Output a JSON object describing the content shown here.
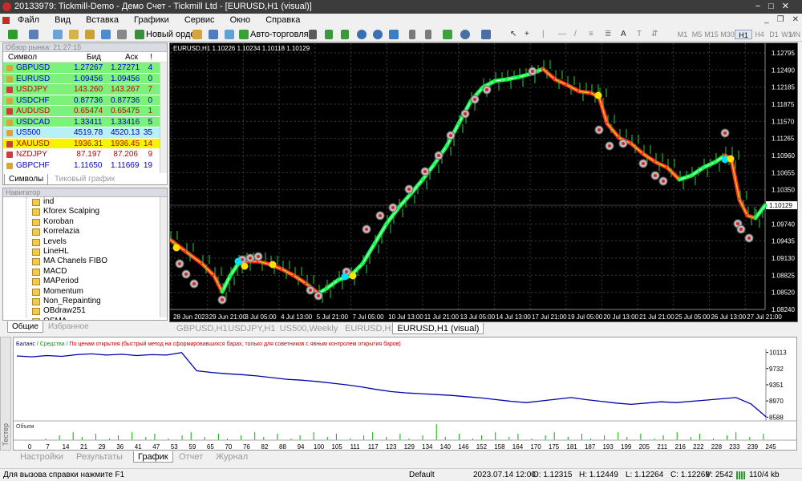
{
  "window": {
    "title": "20133979: Tickmill-Demo - Демо Счет - Tickmill Ltd - [EURUSD,H1 (visual)]"
  },
  "menu": [
    "Файл",
    "Вид",
    "Вставка",
    "Графики",
    "Сервис",
    "Окно",
    "Справка"
  ],
  "toolbar": {
    "new_order": "Новый ордер",
    "autotrading": "Авто-торговля",
    "timeframes": [
      "M1",
      "M5",
      "M15",
      "M30",
      "H1",
      "H4",
      "D1",
      "W1",
      "MN"
    ],
    "active_timeframe": "H1"
  },
  "market_watch": {
    "header": "Обзор рынка: 21:27:15",
    "columns": {
      "symbol": "Символ",
      "bid": "Бид",
      "ask": "Аск",
      "spread": "!"
    },
    "rows": [
      {
        "symbol": "GBPUSD",
        "bid": "1.27267",
        "ask": "1.27271",
        "spread": "4",
        "bg": "#7cf27c",
        "color": "#0000cc"
      },
      {
        "symbol": "EURUSD",
        "bid": "1.09456",
        "ask": "1.09456",
        "spread": "0",
        "bg": "#7cf27c",
        "color": "#0000cc"
      },
      {
        "symbol": "USDJPY",
        "bid": "143.260",
        "ask": "143.267",
        "spread": "7",
        "bg": "#7cf27c",
        "color": "#cc0000"
      },
      {
        "symbol": "USDCHF",
        "bid": "0.87736",
        "ask": "0.87736",
        "spread": "0",
        "bg": "#7cf27c",
        "color": "#0000cc"
      },
      {
        "symbol": "AUDUSD",
        "bid": "0.65474",
        "ask": "0.65475",
        "spread": "1",
        "bg": "#7cf27c",
        "color": "#cc0000"
      },
      {
        "symbol": "USDCAD",
        "bid": "1.33411",
        "ask": "1.33416",
        "spread": "5",
        "bg": "#7cf27c",
        "color": "#0000cc"
      },
      {
        "symbol": "US500",
        "bid": "4519.78",
        "ask": "4520.13",
        "spread": "35",
        "bg": "#b8f0f8",
        "color": "#0000cc"
      },
      {
        "symbol": "XAUUSD",
        "bid": "1936.31",
        "ask": "1936.45",
        "spread": "14",
        "bg": "#f5f500",
        "color": "#cc0000"
      },
      {
        "symbol": "NZDJPY",
        "bid": "87.197",
        "ask": "87.206",
        "spread": "9",
        "bg": "#ffffff",
        "color": "#cc0000"
      },
      {
        "symbol": "GBPCHF",
        "bid": "1.11650",
        "ask": "1.11669",
        "spread": "19",
        "bg": "#ffffff",
        "color": "#0000cc"
      }
    ],
    "tabs": [
      "Символы",
      "Тиковый график"
    ]
  },
  "navigator": {
    "header": "Навигатор",
    "items": [
      "ind",
      "Kforex Scalping",
      "Koroban",
      "Korrelazia",
      "Levels",
      "LineHL",
      "MA Chanels FIBO",
      "MACD",
      "MAPeriod",
      "Momentum",
      "Non_Repainting",
      "OBdraw251",
      "OSMA"
    ],
    "tabs": [
      "Общие",
      "Избранное"
    ]
  },
  "chart": {
    "info": "EURUSD,H1  1.10226 1.10234 1.10118 1.10129",
    "price_labels": [
      "1.12795",
      "1.12490",
      "1.12185",
      "1.11875",
      "1.11570",
      "1.11265",
      "1.10960",
      "1.10655",
      "1.10350",
      "1.10045",
      "1.09740",
      "1.09435",
      "1.09130",
      "1.08825",
      "1.08520",
      "1.08240"
    ],
    "current_price": "1.10129",
    "time_labels": [
      "28 Jun 2023",
      "29 Jun 21:00",
      "3 Jul 05:00",
      "4 Jul 13:00",
      "5 Jul 21:00",
      "7 Jul 05:00",
      "10 Jul 13:00",
      "11 Jul 21:00",
      "13 Jul 05:00",
      "14 Jul 13:00",
      "17 Jul 21:00",
      "19 Jul 05:00",
      "20 Jul 13:00",
      "21 Jul 21:00",
      "25 Jul 05:00",
      "26 Jul 13:00",
      "27 Jul 21:00"
    ],
    "tabs": [
      "GBPUSD,H1",
      "USDJPY,H1",
      "US500,Weekly",
      "EURUSD,H1",
      "EURUSD,H1 (visual)"
    ],
    "active_tab": "EURUSD,H1 (visual)"
  },
  "tester": {
    "legend_balance": "Баланс",
    "legend_equity": "Средства",
    "legend_mode": "По ценам открытия (быстрый метод на сформировавшихся барах, только для советников с явным контролем открытия баров)",
    "volume_label": "Объем",
    "y_labels": [
      "10113",
      "9732",
      "9351",
      "8970",
      "8588"
    ],
    "x_labels": [
      "0",
      "7",
      "14",
      "21",
      "29",
      "36",
      "41",
      "47",
      "53",
      "59",
      "65",
      "70",
      "76",
      "82",
      "88",
      "94",
      "100",
      "105",
      "111",
      "117",
      "123",
      "129",
      "134",
      "140",
      "146",
      "152",
      "158",
      "164",
      "170",
      "175",
      "181",
      "187",
      "193",
      "199",
      "205",
      "211",
      "216",
      "222",
      "228",
      "233",
      "239",
      "245"
    ],
    "tabs": [
      "Настройки",
      "Результаты",
      "График",
      "Отчет",
      "Журнал"
    ],
    "active_tab": "График",
    "side_label": "Тестер"
  },
  "chart_data": {
    "type": "line",
    "title": "",
    "xlabel": "",
    "ylabel": "",
    "x": [
      0,
      5,
      10,
      15,
      20,
      25,
      30,
      35,
      40,
      45,
      50,
      55,
      60,
      65,
      70,
      75,
      80,
      85,
      90,
      95,
      100,
      105,
      110,
      115,
      120,
      125,
      130,
      135,
      140,
      145,
      150,
      155,
      160,
      165,
      170,
      175,
      180,
      185,
      190,
      195,
      200,
      205,
      210,
      215,
      220,
      225,
      230,
      235,
      240,
      245,
      250
    ],
    "series": [
      {
        "values": [
          10030,
          10010,
          10040,
          10020,
          10060,
          10080,
          10050,
          10070,
          10040,
          10060,
          10050,
          10110,
          9680,
          9640,
          9610,
          9590,
          9560,
          9520,
          9480,
          9460,
          9430,
          9390,
          9350,
          9300,
          9240,
          9190,
          9160,
          9140,
          9120,
          9100,
          9070,
          9040,
          9000,
          8960,
          8930,
          8970,
          9010,
          9050,
          9000,
          8960,
          8920,
          8890,
          8920,
          8950,
          8930,
          8960,
          8990,
          9020,
          9050,
          8900,
          8600
        ]
      }
    ],
    "ylim": [
      8500,
      10200
    ]
  },
  "status": {
    "help": "Для вызова справки нажмите F1",
    "profile": "Default",
    "datetime": "2023.07.14 12:00",
    "open": "O: 1.12315",
    "high": "H: 1.12449",
    "low": "L: 1.12264",
    "close": "C: 1.12268",
    "volume": "V: 2542",
    "traffic": "110/4 kb"
  }
}
